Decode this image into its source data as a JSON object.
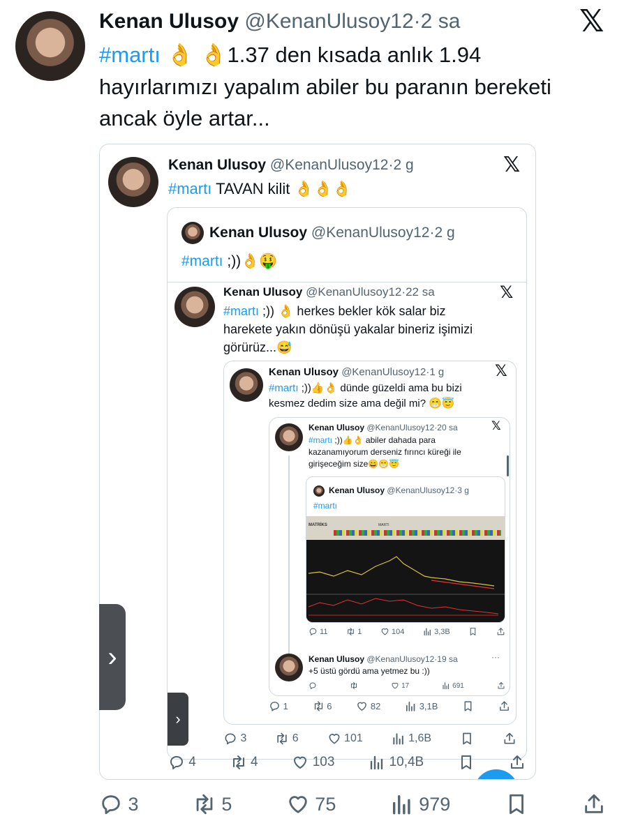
{
  "tweet": {
    "name": "Kenan Ulusoy",
    "handle": "@KenanUlusoy12",
    "dot": "·",
    "time": "2 sa",
    "hashtag": "#martı",
    "emojis": "👌 👌",
    "text_line1": "1.37 den kısada anlık 1.94",
    "text_line2": "hayırlarımızı yapalım abiler bu paranın bereketi",
    "text_line3": "ancak öyle artar...",
    "stats": {
      "replies": "3",
      "retweets": "5",
      "likes": "75",
      "views": "979"
    }
  },
  "q1": {
    "name": "Kenan Ulusoy",
    "handle": "@KenanUlusoy12",
    "dot": "·",
    "time": "2 g",
    "hashtag": "#martı",
    "text": "TAVAN kilit",
    "emojis": "👌👌👌",
    "stats": {
      "replies": "4",
      "retweets": "4",
      "likes": "103",
      "views": "10,4B"
    }
  },
  "q2": {
    "name": "Kenan Ulusoy",
    "handle": "@KenanUlusoy12",
    "dot": "·",
    "time": "2 g",
    "hashtag": "#martı",
    "text": ";))",
    "emojis": "👌🤑"
  },
  "q3": {
    "name": "Kenan Ulusoy",
    "handle": "@KenanUlusoy12",
    "dot": "·",
    "time": "22 sa",
    "hashtag": "#martı",
    "text_line1": ";)) 👌 herkes bekler kök salar biz",
    "text_line2": "harekete yakın dönüşü yakalar bineriz işimizi",
    "text_line3": "görürüz...😅",
    "stats": {
      "replies": "3",
      "retweets": "6",
      "likes": "101",
      "views": "1,6B"
    }
  },
  "q4": {
    "name": "Kenan Ulusoy",
    "handle": "@KenanUlusoy12",
    "dot": "·",
    "time": "1 g",
    "hashtag": "#martı",
    "text_line1": ";))👍👌 dünde güzeldi ama bu bizi",
    "text_line2": "kesmez dedim size ama değil mi? 😁😇",
    "stats": {
      "replies": "1",
      "retweets": "6",
      "likes": "82",
      "views": "3,1B"
    }
  },
  "q5": {
    "name": "Kenan Ulusoy",
    "handle": "@KenanUlusoy12",
    "dot": "·",
    "time": "20 sa",
    "hashtag": "#martı",
    "text_line1": ";))👍👌 abiler dahada para",
    "text_line2": "kazanamıyorum derseniz fırıncı küreği ile",
    "text_line3": "girişeceğim size😄😁😇",
    "stats": {
      "replies": "11",
      "retweets": "1",
      "likes": "104",
      "views": "3,3B"
    }
  },
  "q6": {
    "name": "Kenan Ulusoy",
    "handle": "@KenanUlusoy12",
    "dot": "·",
    "time": "3 g",
    "hashtag": "#martı"
  },
  "q7": {
    "name": "Kenan Ulusoy",
    "handle": "@KenanUlusoy12",
    "dot": "·",
    "time": "19 sa",
    "text": "+5 üstü gördü ama yetmez bu :))",
    "more": "···",
    "stats": {
      "replies": "",
      "retweets": "",
      "likes": "17",
      "views": "691"
    }
  },
  "chart_header": {
    "brand": "MATRİKS",
    "symbol": "MARTI"
  },
  "colors": {
    "link": "#1d9bf0",
    "muted": "#536471",
    "border": "#cfd9de"
  },
  "icons": [
    "x-logo-icon",
    "reply-icon",
    "retweet-icon",
    "like-icon",
    "views-icon",
    "bookmark-icon",
    "share-icon",
    "chevron-right-icon"
  ]
}
